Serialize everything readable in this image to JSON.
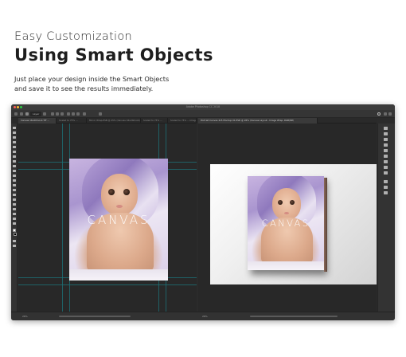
{
  "hero": {
    "subtitle": "Easy Customization",
    "title": "Using Smart Objects",
    "description_line1": "Just place your design inside the Smart Objects",
    "description_line2": "and save it to see the results immediately."
  },
  "window": {
    "title": "Adobe Photoshop CC 2018",
    "options_layer_label": "Layer",
    "traffic_lights": [
      "#ff5f57",
      "#febc2e",
      "#28c840"
    ]
  },
  "tabs_left": [
    "Canvas 16x20mock.TIF ...",
    "Scaled to 75% ...",
    "Mirror Wrap-PSB @ 25% (Canvas 16x20mock) ...",
    "Scaled to 75% ...",
    "Scaled to 75% ... Image ..."
  ],
  "tabs_right": [
    "Portrait Canvas 4x5 Mockup 01.PSD @ 26% (Canvas Layout - Image Wrap, RGB/8#)"
  ],
  "artwork": {
    "overlay_text": "CANVAS"
  },
  "status": {
    "left_zoom": "26%",
    "right_zoom": "26%"
  },
  "colors": {
    "app_background": "#2b2b2b",
    "guide": "#1d6f76"
  }
}
